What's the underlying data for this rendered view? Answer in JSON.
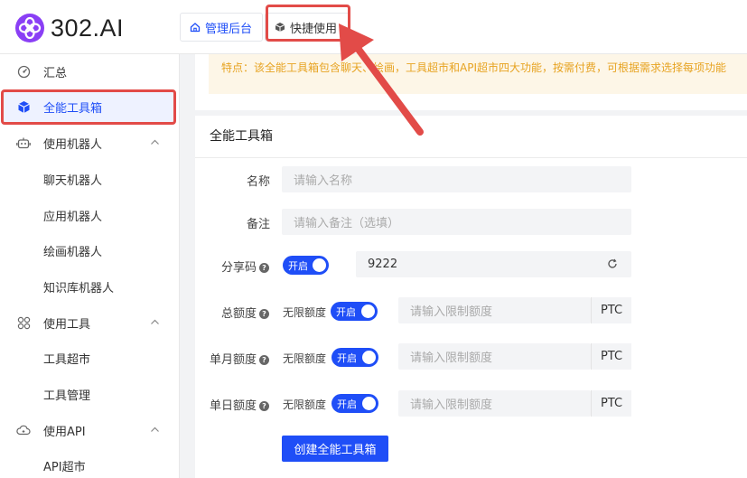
{
  "brand": {
    "name": "302.AI",
    "logo_icon": "flower-logo-icon",
    "accent": "#8a3ff5"
  },
  "header": {
    "tabs": [
      {
        "label": "管理后台",
        "icon": "home-icon"
      },
      {
        "label": "快捷使用",
        "icon": "cube-icon"
      }
    ]
  },
  "sidebar": {
    "items": [
      {
        "label": "汇总",
        "icon": "dashboard-icon"
      },
      {
        "label": "全能工具箱",
        "icon": "cube-icon",
        "active": true
      },
      {
        "label": "使用机器人",
        "icon": "robot-icon",
        "expanded": true
      },
      {
        "label": "聊天机器人"
      },
      {
        "label": "应用机器人"
      },
      {
        "label": "绘画机器人"
      },
      {
        "label": "知识库机器人"
      },
      {
        "label": "使用工具",
        "icon": "apps-icon",
        "expanded": true
      },
      {
        "label": "工具超市"
      },
      {
        "label": "工具管理"
      },
      {
        "label": "使用API",
        "icon": "cloud-icon",
        "expanded": true
      },
      {
        "label": "API超市"
      }
    ]
  },
  "notice": {
    "text": "特点：该全能工具箱包含聊天、绘画，工具超市和API超市四大功能，按需付费，可根据需求选择每项功能"
  },
  "form": {
    "title": "全能工具箱",
    "name_label": "名称",
    "name_placeholder": "请输入名称",
    "note_label": "备注",
    "note_placeholder": "请输入备注（选填）",
    "share_label": "分享码",
    "share_toggle": "开启",
    "share_value": "9222",
    "total_label": "总额度",
    "monthly_label": "单月额度",
    "daily_label": "单日额度",
    "unlimited_label": "无限额度",
    "toggle_on": "开启",
    "limit_placeholder": "请输入限制额度",
    "unit": "PTC",
    "submit": "创建全能工具箱"
  },
  "colors": {
    "primary": "#1f4ef7",
    "highlight": "#e24b48",
    "notice_text": "#e7a321"
  }
}
